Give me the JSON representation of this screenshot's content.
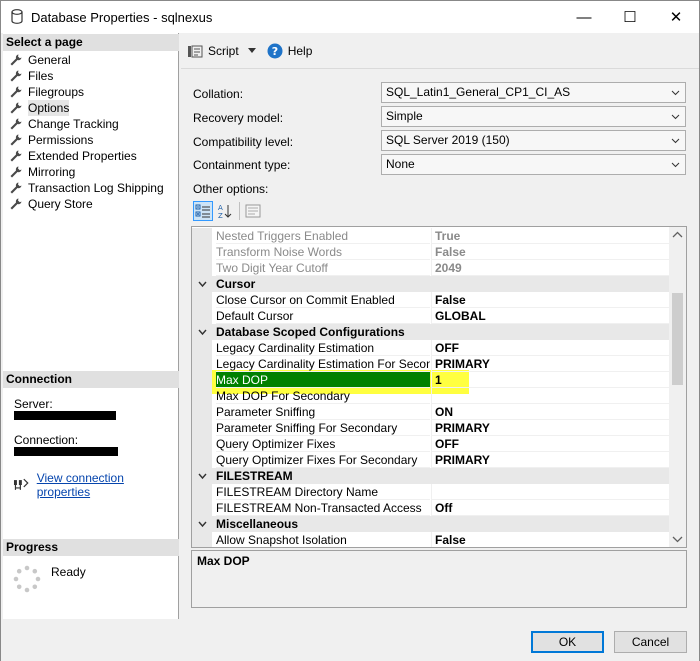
{
  "window": {
    "title": "Database Properties - sqlnexus",
    "minimize": "—",
    "maximize": "☐",
    "close": "✕"
  },
  "left": {
    "select_page_header": "Select a page",
    "pages": [
      {
        "label": "General"
      },
      {
        "label": "Files"
      },
      {
        "label": "Filegroups"
      },
      {
        "label": "Options"
      },
      {
        "label": "Change Tracking"
      },
      {
        "label": "Permissions"
      },
      {
        "label": "Extended Properties"
      },
      {
        "label": "Mirroring"
      },
      {
        "label": "Transaction Log Shipping"
      },
      {
        "label": "Query Store"
      }
    ],
    "selected_page": "Options",
    "connection_header": "Connection",
    "server_label": "Server:",
    "connection_label": "Connection:",
    "view_connection_link": "View connection properties",
    "progress_header": "Progress",
    "progress_status": "Ready"
  },
  "toolbar": {
    "script_label": "Script",
    "help_label": "Help"
  },
  "form": {
    "collation_label": "Collation:",
    "collation_value": "SQL_Latin1_General_CP1_CI_AS",
    "recovery_label": "Recovery model:",
    "recovery_value": "Simple",
    "compat_label": "Compatibility level:",
    "compat_value": "SQL Server 2019 (150)",
    "containment_label": "Containment type:",
    "containment_value": "None",
    "other_options_label": "Other options:"
  },
  "grid": {
    "rows": [
      {
        "kind": "prop",
        "name": "Nested Triggers Enabled",
        "value": "True",
        "disabled": true
      },
      {
        "kind": "prop",
        "name": "Transform Noise Words",
        "value": "False",
        "disabled": true
      },
      {
        "kind": "prop",
        "name": "Two Digit Year Cutoff",
        "value": "2049",
        "disabled": true
      },
      {
        "kind": "cat",
        "name": "Cursor"
      },
      {
        "kind": "prop",
        "name": "Close Cursor on Commit Enabled",
        "value": "False"
      },
      {
        "kind": "prop",
        "name": "Default Cursor",
        "value": "GLOBAL"
      },
      {
        "kind": "cat",
        "name": "Database Scoped Configurations"
      },
      {
        "kind": "prop",
        "name": "Legacy Cardinality Estimation",
        "value": "OFF"
      },
      {
        "kind": "prop",
        "name": "Legacy Cardinality Estimation For Secondary",
        "value": "PRIMARY"
      },
      {
        "kind": "prop",
        "name": "Max DOP",
        "value": "1",
        "selected": true
      },
      {
        "kind": "prop",
        "name": "Max DOP For Secondary",
        "value": ""
      },
      {
        "kind": "prop",
        "name": "Parameter Sniffing",
        "value": "ON"
      },
      {
        "kind": "prop",
        "name": "Parameter Sniffing For Secondary",
        "value": "PRIMARY"
      },
      {
        "kind": "prop",
        "name": "Query Optimizer Fixes",
        "value": "OFF"
      },
      {
        "kind": "prop",
        "name": "Query Optimizer Fixes For Secondary",
        "value": "PRIMARY"
      },
      {
        "kind": "cat",
        "name": "FILESTREAM"
      },
      {
        "kind": "prop",
        "name": "FILESTREAM Directory Name",
        "value": ""
      },
      {
        "kind": "prop",
        "name": "FILESTREAM Non-Transacted Access",
        "value": "Off"
      },
      {
        "kind": "cat",
        "name": "Miscellaneous"
      },
      {
        "kind": "prop",
        "name": "Allow Snapshot Isolation",
        "value": "False"
      }
    ],
    "description_title": "Max DOP"
  },
  "buttons": {
    "ok": "OK",
    "cancel": "Cancel"
  },
  "colors": {
    "selected_row": "#008000",
    "highlight": "#ffff00",
    "link": "#0645ad",
    "ok_border": "#0078d7"
  }
}
